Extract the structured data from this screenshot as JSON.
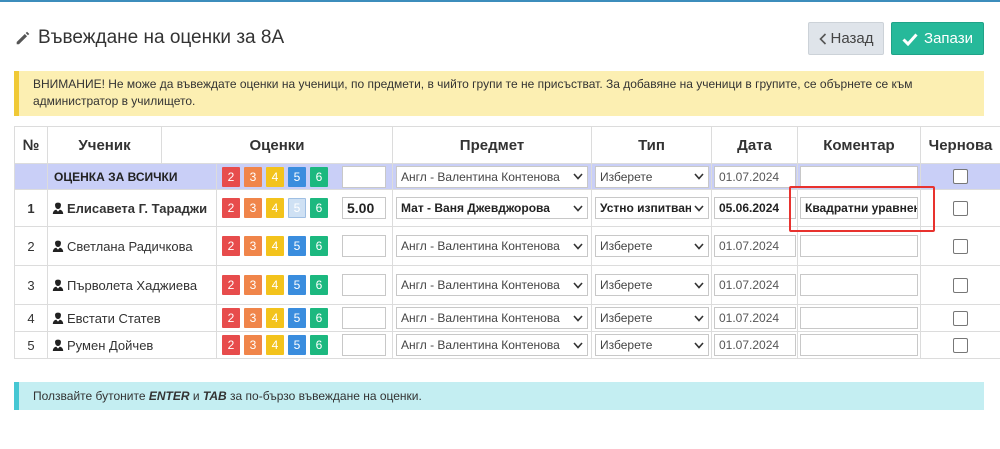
{
  "header": {
    "title": "Въвеждане на оценки за 8А",
    "back_label": "Назад",
    "save_label": "Запази"
  },
  "warning": {
    "text": "ВНИМАНИЕ! Не може да въвеждате оценки на ученици, по предмети, в чийто групи те не присъстват. За добавяне на ученици в групите, се обърнете се към администратор в училището."
  },
  "info": {
    "prefix": "Ползвайте бутоните ",
    "enter": "ENTER",
    "and": " и ",
    "tab": "TAB",
    "suffix": " за по-бързо въвеждане на оценки."
  },
  "table": {
    "headers": {
      "num": "№",
      "student": "Ученик",
      "grades": "Оценки",
      "subject": "Предмет",
      "type": "Тип",
      "date": "Дата",
      "comment": "Коментар",
      "draft": "Чернова"
    },
    "grade_buttons": [
      "2",
      "3",
      "4",
      "5",
      "6"
    ],
    "all_row": {
      "label": "ОЦЕНКА ЗА ВСИЧКИ",
      "grade": "",
      "subject": "Англ - Валентина Контенова",
      "type": "Изберете",
      "date": "01.07.2024",
      "comment": ""
    },
    "rows": [
      {
        "num": "1",
        "name": "Елисавета Г. Тараджи",
        "grade": "5.00",
        "subject": "Мат - Ваня Джевджорова",
        "type": "Устно изпитване",
        "date": "05.06.2024",
        "comment": "Квадратни уравнения"
      },
      {
        "num": "2",
        "name": "Светлана Радичкова",
        "grade": "",
        "subject": "Англ - Валентина Контенова",
        "type": "Изберете",
        "date": "01.07.2024",
        "comment": ""
      },
      {
        "num": "3",
        "name": "Първолета Хаджиева",
        "grade": "",
        "subject": "Англ - Валентина Контенова",
        "type": "Изберете",
        "date": "01.07.2024",
        "comment": ""
      },
      {
        "num": "4",
        "name": "Евстати Статев",
        "grade": "",
        "subject": "Англ - Валентина Контенова",
        "type": "Изберете",
        "date": "01.07.2024",
        "comment": ""
      },
      {
        "num": "5",
        "name": "Румен Дойчев",
        "grade": "",
        "subject": "Англ - Валентина Контенова",
        "type": "Изберете",
        "date": "01.07.2024",
        "comment": ""
      }
    ]
  },
  "colors": {
    "accent": "#3c8dbc",
    "save": "#26b99a",
    "grade_2": "#e74c4c",
    "grade_3": "#f0854a",
    "grade_4": "#f3c31c",
    "grade_5": "#3a8dde",
    "grade_6": "#1cb87f",
    "all_row": "#c9cff7",
    "warning_bg": "#fcefb2",
    "info_bg": "#c4eef2",
    "highlight": "#e8322e"
  },
  "icons": {
    "title": "pencil-icon",
    "back": "chevron-left-icon",
    "save": "check-icon",
    "student": "user-icon",
    "select": "chevron-down-icon"
  }
}
